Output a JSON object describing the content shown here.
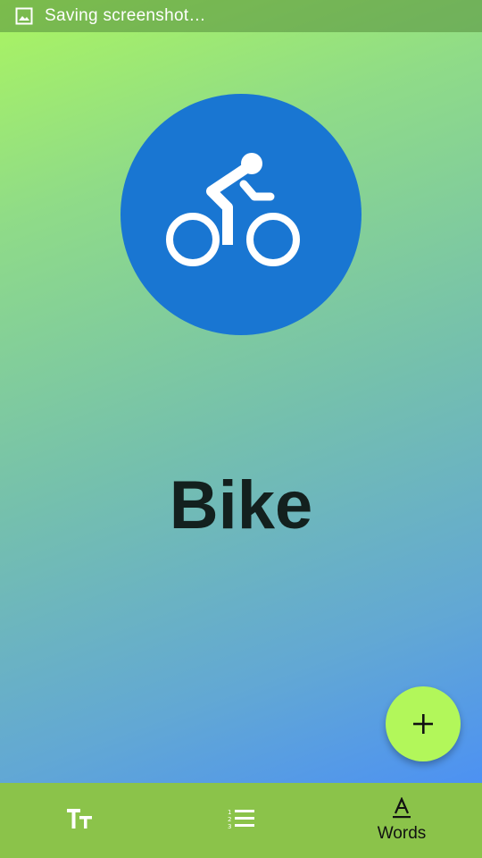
{
  "status_bar": {
    "icon": "image-icon",
    "text": "Saving screenshot…"
  },
  "card": {
    "icon": "bike-icon",
    "circle_color": "#1976d2",
    "word": "Bike"
  },
  "fab": {
    "icon": "plus-icon",
    "color": "#b2f75a"
  },
  "bottom_nav": {
    "color": "#8bc34a",
    "items": [
      {
        "icon": "text-size-icon",
        "label": ""
      },
      {
        "icon": "numbered-list-icon",
        "label": ""
      },
      {
        "icon": "text-format-icon",
        "label": "Words"
      }
    ]
  }
}
